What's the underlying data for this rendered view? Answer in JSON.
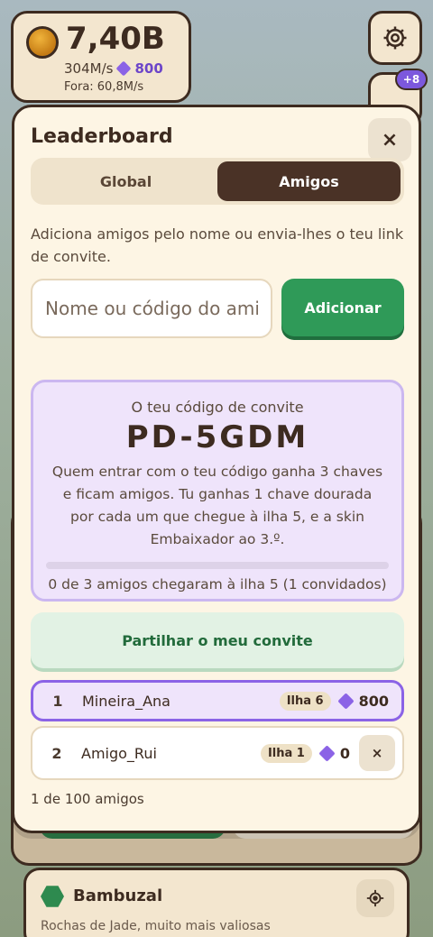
{
  "hud": {
    "coins": "7,40B",
    "rate": "304M/s",
    "gems": "800",
    "force": "Fora: 60,8M/s",
    "notification_badge": "+8"
  },
  "background": {
    "region_title": "Bambuzal",
    "region_subtitle": "Rochas de Jade, muito mais valiosas"
  },
  "modal": {
    "title": "Leaderboard",
    "close_label": "×",
    "tabs": [
      {
        "label": "Global",
        "active": false
      },
      {
        "label": "Amigos",
        "active": true
      }
    ],
    "hint": "Adiciona amigos pelo nome ou envia-lhes o teu link de convite.",
    "input_placeholder": "Nome ou código do amigo",
    "add_button": "Adicionar",
    "invite": {
      "label": "O teu código de convite",
      "code": "PD-5GDM",
      "description": "Quem entrar com o teu código ganha 3 chaves e ficam amigos. Tu ganhas 1 chave dourada por cada um que chegue à ilha 5, e a skin Embaixador ao 3.º.",
      "progress_fraction": 0,
      "progress_text": "0 de 3 amigos chegaram à ilha 5 (1 convidados)"
    },
    "share_button": "Partilhar o meu convite",
    "friends": [
      {
        "rank": "1",
        "name": "Mineira_Ana",
        "island": "Ilha 6",
        "gems": "800",
        "is_me": true
      },
      {
        "rank": "2",
        "name": "Amigo_Rui",
        "island": "Ilha 1",
        "gems": "0",
        "is_me": false
      }
    ],
    "remove_label": "×",
    "footer": "1 de 100 amigos"
  },
  "colors": {
    "accent_purple": "#8b63e6",
    "green": "#2f9a58",
    "dark_brown": "#3d2b20",
    "cream": "#fdf5e4"
  }
}
